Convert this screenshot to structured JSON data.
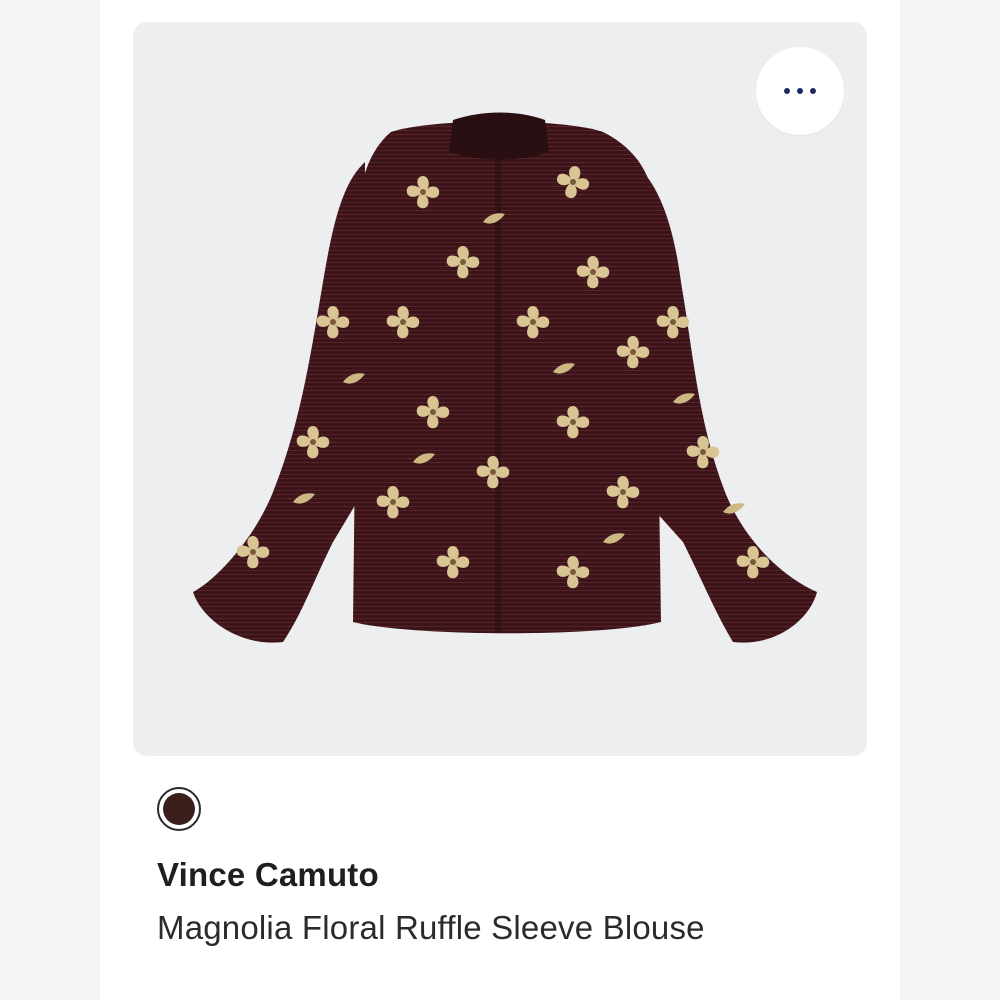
{
  "colors": {
    "background": "#ffffff",
    "card_background": "#eceef0",
    "more_dots": "#1c2b5a",
    "blouse_base": "#3a1418",
    "print_gold": "#d9c493"
  },
  "more_menu": {
    "icon": "more-horizontal-icon"
  },
  "product": {
    "image_alt": "Burgundy and gold floral ruffle sleeve blouse",
    "swatch_color": "#3a1f1c",
    "brand": "Vince Camuto",
    "name": "Magnolia Floral Ruffle Sleeve Blouse"
  }
}
